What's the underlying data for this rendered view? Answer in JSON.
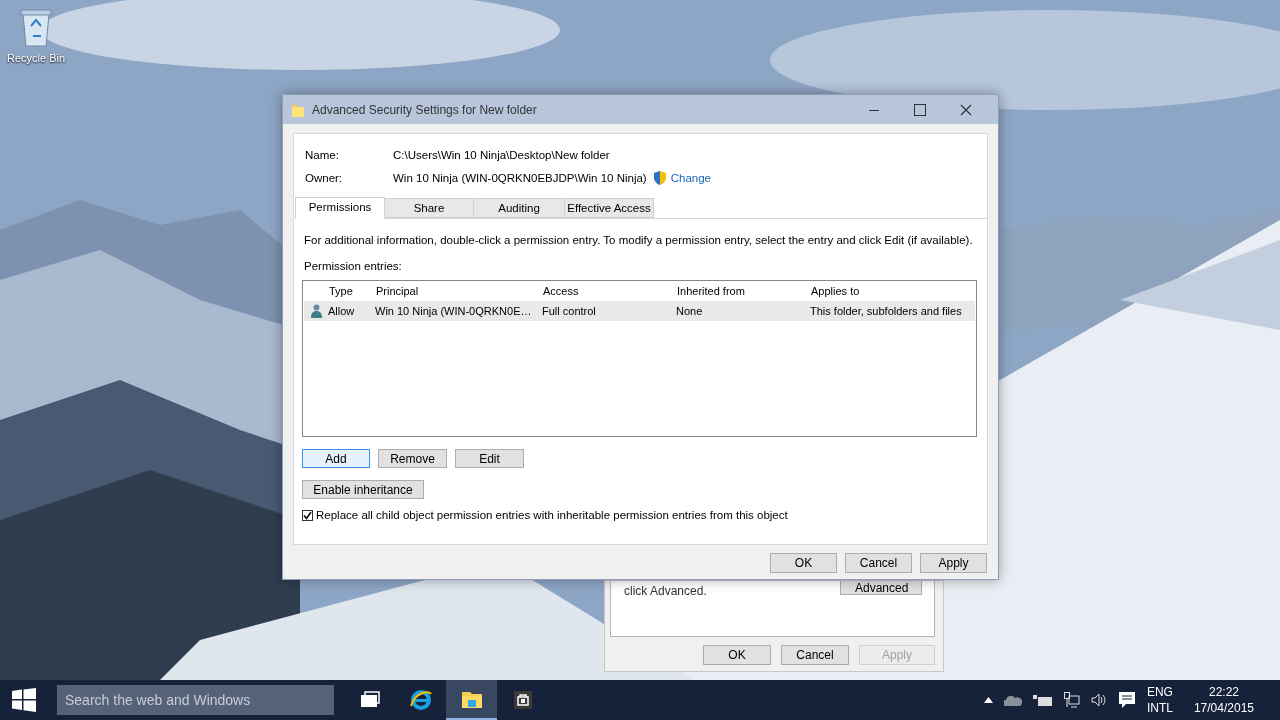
{
  "desktop": {
    "icons": [
      {
        "label": "Recycle Bin"
      }
    ]
  },
  "background_window": {
    "note": "click Advanced.",
    "advanced_button": "Advanced",
    "buttons": [
      {
        "label": "OK",
        "disabled": false
      },
      {
        "label": "Cancel",
        "disabled": false
      },
      {
        "label": "Apply",
        "disabled": true
      }
    ]
  },
  "dialog": {
    "title": "Advanced Security Settings for New folder",
    "fields": [
      {
        "label": "Name:",
        "value": "C:\\Users\\Win 10 Ninja\\Desktop\\New folder"
      },
      {
        "label": "Owner:",
        "value": "Win 10 Ninja (WIN-0QRKN0EBJDP\\Win 10 Ninja)",
        "link": "Change"
      }
    ],
    "tabs": [
      {
        "label": "Permissions",
        "selected": true
      },
      {
        "label": "Share",
        "selected": false
      },
      {
        "label": "Auditing",
        "selected": false
      },
      {
        "label": "Effective Access",
        "selected": false
      }
    ],
    "info": "For additional information, double-click a permission entry. To modify a permission entry, select the entry and click Edit (if available).",
    "entries_label": "Permission entries:",
    "table": {
      "columns": [
        "Type",
        "Principal",
        "Access",
        "Inherited from",
        "Applies to"
      ],
      "rows": [
        {
          "cells": [
            "Allow",
            "Win 10 Ninja (WIN-0QRKN0E…",
            "Full control",
            "None",
            "This folder, subfolders and files"
          ],
          "selected": true
        }
      ]
    },
    "entry_buttons": [
      {
        "label": "Add",
        "focused": true
      },
      {
        "label": "Remove",
        "focused": false
      },
      {
        "label": "Edit",
        "focused": false
      }
    ],
    "inheritance_button": "Enable inheritance",
    "replace_checkbox": {
      "label": "Replace all child object permission entries with inheritable permission entries from this object",
      "checked": true
    },
    "buttons": [
      "OK",
      "Cancel",
      "Apply"
    ]
  },
  "taskbar": {
    "search": {
      "placeholder": "Search the web and Windows"
    },
    "apps": [
      {
        "kind": "task-view",
        "active": false
      },
      {
        "kind": "browser",
        "active": false
      },
      {
        "kind": "explorer",
        "active": true
      },
      {
        "kind": "store",
        "active": false
      }
    ],
    "language": [
      "ENG",
      "INTL"
    ],
    "time": "22:22",
    "date": "17/04/2015"
  }
}
